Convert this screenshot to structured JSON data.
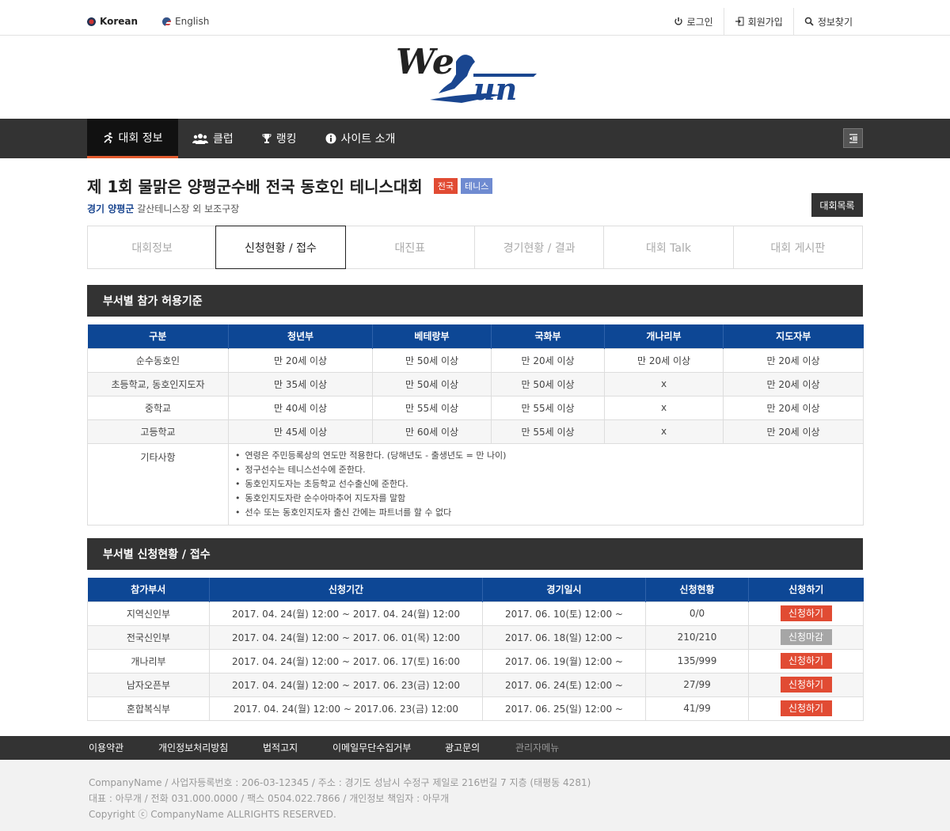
{
  "topbar": {
    "lang_ko": "Korean",
    "lang_en": "English",
    "login": "로그인",
    "join": "회원가입",
    "find": "정보찾기"
  },
  "nav": {
    "items": [
      "대회 정보",
      "클럽",
      "랭킹",
      "사이트 소개"
    ],
    "active_index": 0
  },
  "event": {
    "title": "제 1회 물맑은 양평군수배 전국 동호인 테니스대회",
    "badge1": "전국",
    "badge2": "테니스",
    "region": "경기 양평군",
    "venue": "갈산테니스장 외 보조구장",
    "list_button": "대회목록"
  },
  "tabs": [
    "대회정보",
    "신청현황 / 접수",
    "대진표",
    "경기현황 / 결과",
    "대회 Talk",
    "대회 게시판"
  ],
  "criteria": {
    "heading": "부서별 참가 허용기준",
    "headers": [
      "구분",
      "청년부",
      "베테랑부",
      "국화부",
      "개나리부",
      "지도자부"
    ],
    "rows": [
      [
        "순수동호인",
        "만 20세 이상",
        "만 50세 이상",
        "만 20세 이상",
        "만 20세 이상",
        "만 20세 이상"
      ],
      [
        "초등학교, 동호인지도자",
        "만 35세 이상",
        "만 50세 이상",
        "만 50세 이상",
        "x",
        "만 20세 이상"
      ],
      [
        "중학교",
        "만 40세 이상",
        "만 55세 이상",
        "만 55세 이상",
        "x",
        "만 20세 이상"
      ],
      [
        "고등학교",
        "만 45세 이상",
        "만 60세 이상",
        "만 55세 이상",
        "x",
        "만 20세 이상"
      ]
    ],
    "notes_label": "기타사항",
    "notes": [
      "연령은 주민등록상의 연도만 적용한다. (당해년도 - 출생년도 = 만 나이)",
      "정구선수는 테니스선수에 준한다.",
      "동호인지도자는 초등학교 선수출신에 준한다.",
      "동호인지도자란 순수아마추어 지도자를 말함",
      "선수 또는 동호인지도자 출신 간에는 파트너를 할 수 없다"
    ]
  },
  "registration": {
    "heading": "부서별 신청현황 / 접수",
    "headers": [
      "참가부서",
      "신청기간",
      "경기일시",
      "신청현황",
      "신청하기"
    ],
    "rows": [
      [
        "지역신인부",
        "2017. 04. 24(월) 12:00 ~ 2017. 04. 24(월)  12:00",
        "2017. 06. 10(토) 12:00 ~",
        "0/0",
        "신청하기"
      ],
      [
        "전국신인부",
        "2017. 04. 24(월) 12:00 ~ 2017. 06. 01(목) 12:00",
        "2017. 06. 18(일) 12:00 ~",
        "210/210",
        "신청마감"
      ],
      [
        "개나리부",
        "2017. 04. 24(월) 12:00 ~ 2017. 06. 17(토) 16:00",
        "2017. 06. 19(월) 12:00 ~",
        "135/999",
        "신청하기"
      ],
      [
        "남자오픈부",
        "2017. 04. 24(월) 12:00 ~ 2017. 06. 23(금) 12:00",
        "2017. 06. 24(토) 12:00 ~",
        "27/99",
        "신청하기"
      ],
      [
        "혼합복식부",
        "2017. 04. 24(월) 12:00 ~ 2017.06. 23(금) 12:00",
        "2017. 06. 25(일) 12:00 ~",
        "41/99",
        "신청하기"
      ]
    ]
  },
  "footer": {
    "links": [
      "이용약관",
      "개인정보처리방침",
      "법적고지",
      "이메일무단수집거부",
      "광고문의",
      "관리자메뉴"
    ],
    "line1": "CompanyName / 사업자등록번호 : 206-03-12345 / 주소 : 경기도 성남시 수정구 제일로 216번길 7 지층 (태평동 4281)",
    "line2": "대표 : 아무개 / 전화 031.000.0000 / 팩스 0504.022.7866 / 개인정보 책임자 : 아무개",
    "line3": "Copyright ⓒ CompanyName ALLRIGHTS RESERVED."
  },
  "colors": {
    "navy": "#0d4795",
    "red": "#e14b33",
    "dark": "#333333"
  }
}
